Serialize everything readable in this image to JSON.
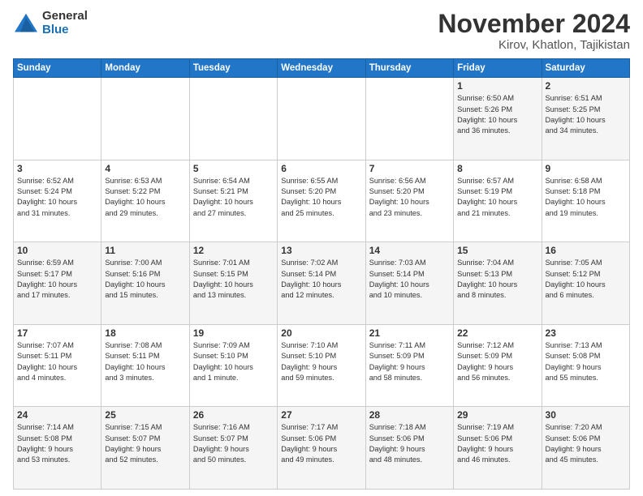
{
  "logo": {
    "general": "General",
    "blue": "Blue"
  },
  "header": {
    "month": "November 2024",
    "location": "Kirov, Khatlon, Tajikistan"
  },
  "weekdays": [
    "Sunday",
    "Monday",
    "Tuesday",
    "Wednesday",
    "Thursday",
    "Friday",
    "Saturday"
  ],
  "weeks": [
    [
      {
        "day": "",
        "info": ""
      },
      {
        "day": "",
        "info": ""
      },
      {
        "day": "",
        "info": ""
      },
      {
        "day": "",
        "info": ""
      },
      {
        "day": "",
        "info": ""
      },
      {
        "day": "1",
        "info": "Sunrise: 6:50 AM\nSunset: 5:26 PM\nDaylight: 10 hours\nand 36 minutes."
      },
      {
        "day": "2",
        "info": "Sunrise: 6:51 AM\nSunset: 5:25 PM\nDaylight: 10 hours\nand 34 minutes."
      }
    ],
    [
      {
        "day": "3",
        "info": "Sunrise: 6:52 AM\nSunset: 5:24 PM\nDaylight: 10 hours\nand 31 minutes."
      },
      {
        "day": "4",
        "info": "Sunrise: 6:53 AM\nSunset: 5:22 PM\nDaylight: 10 hours\nand 29 minutes."
      },
      {
        "day": "5",
        "info": "Sunrise: 6:54 AM\nSunset: 5:21 PM\nDaylight: 10 hours\nand 27 minutes."
      },
      {
        "day": "6",
        "info": "Sunrise: 6:55 AM\nSunset: 5:20 PM\nDaylight: 10 hours\nand 25 minutes."
      },
      {
        "day": "7",
        "info": "Sunrise: 6:56 AM\nSunset: 5:20 PM\nDaylight: 10 hours\nand 23 minutes."
      },
      {
        "day": "8",
        "info": "Sunrise: 6:57 AM\nSunset: 5:19 PM\nDaylight: 10 hours\nand 21 minutes."
      },
      {
        "day": "9",
        "info": "Sunrise: 6:58 AM\nSunset: 5:18 PM\nDaylight: 10 hours\nand 19 minutes."
      }
    ],
    [
      {
        "day": "10",
        "info": "Sunrise: 6:59 AM\nSunset: 5:17 PM\nDaylight: 10 hours\nand 17 minutes."
      },
      {
        "day": "11",
        "info": "Sunrise: 7:00 AM\nSunset: 5:16 PM\nDaylight: 10 hours\nand 15 minutes."
      },
      {
        "day": "12",
        "info": "Sunrise: 7:01 AM\nSunset: 5:15 PM\nDaylight: 10 hours\nand 13 minutes."
      },
      {
        "day": "13",
        "info": "Sunrise: 7:02 AM\nSunset: 5:14 PM\nDaylight: 10 hours\nand 12 minutes."
      },
      {
        "day": "14",
        "info": "Sunrise: 7:03 AM\nSunset: 5:14 PM\nDaylight: 10 hours\nand 10 minutes."
      },
      {
        "day": "15",
        "info": "Sunrise: 7:04 AM\nSunset: 5:13 PM\nDaylight: 10 hours\nand 8 minutes."
      },
      {
        "day": "16",
        "info": "Sunrise: 7:05 AM\nSunset: 5:12 PM\nDaylight: 10 hours\nand 6 minutes."
      }
    ],
    [
      {
        "day": "17",
        "info": "Sunrise: 7:07 AM\nSunset: 5:11 PM\nDaylight: 10 hours\nand 4 minutes."
      },
      {
        "day": "18",
        "info": "Sunrise: 7:08 AM\nSunset: 5:11 PM\nDaylight: 10 hours\nand 3 minutes."
      },
      {
        "day": "19",
        "info": "Sunrise: 7:09 AM\nSunset: 5:10 PM\nDaylight: 10 hours\nand 1 minute."
      },
      {
        "day": "20",
        "info": "Sunrise: 7:10 AM\nSunset: 5:10 PM\nDaylight: 9 hours\nand 59 minutes."
      },
      {
        "day": "21",
        "info": "Sunrise: 7:11 AM\nSunset: 5:09 PM\nDaylight: 9 hours\nand 58 minutes."
      },
      {
        "day": "22",
        "info": "Sunrise: 7:12 AM\nSunset: 5:09 PM\nDaylight: 9 hours\nand 56 minutes."
      },
      {
        "day": "23",
        "info": "Sunrise: 7:13 AM\nSunset: 5:08 PM\nDaylight: 9 hours\nand 55 minutes."
      }
    ],
    [
      {
        "day": "24",
        "info": "Sunrise: 7:14 AM\nSunset: 5:08 PM\nDaylight: 9 hours\nand 53 minutes."
      },
      {
        "day": "25",
        "info": "Sunrise: 7:15 AM\nSunset: 5:07 PM\nDaylight: 9 hours\nand 52 minutes."
      },
      {
        "day": "26",
        "info": "Sunrise: 7:16 AM\nSunset: 5:07 PM\nDaylight: 9 hours\nand 50 minutes."
      },
      {
        "day": "27",
        "info": "Sunrise: 7:17 AM\nSunset: 5:06 PM\nDaylight: 9 hours\nand 49 minutes."
      },
      {
        "day": "28",
        "info": "Sunrise: 7:18 AM\nSunset: 5:06 PM\nDaylight: 9 hours\nand 48 minutes."
      },
      {
        "day": "29",
        "info": "Sunrise: 7:19 AM\nSunset: 5:06 PM\nDaylight: 9 hours\nand 46 minutes."
      },
      {
        "day": "30",
        "info": "Sunrise: 7:20 AM\nSunset: 5:06 PM\nDaylight: 9 hours\nand 45 minutes."
      }
    ]
  ]
}
